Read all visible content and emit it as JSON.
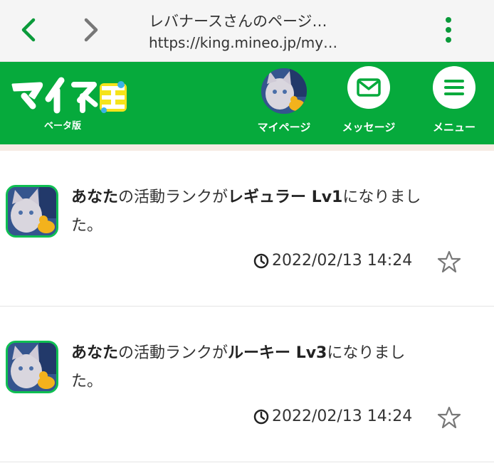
{
  "browser": {
    "page_title": "レバナースさんのページ…",
    "url": "https://king.mineo.jp/my…"
  },
  "header": {
    "logo_text": "マイネ王",
    "logo_sub": "ベータ版",
    "buttons": [
      {
        "label": "マイページ"
      },
      {
        "label": "メッセージ"
      },
      {
        "label": "メニュー"
      }
    ]
  },
  "feed": {
    "items": [
      {
        "subject": "あなた",
        "middle": "の活動ランクが",
        "rank": "レギュラー Lv1",
        "line1_tail": "になりまし",
        "line2": "た。",
        "timestamp": "2022/02/13 14:24"
      },
      {
        "subject": "あなた",
        "middle": "の活動ランクが",
        "rank": "ルーキー Lv3",
        "line1_tail": "になりまし",
        "line2": "た。",
        "timestamp": "2022/02/13 14:24"
      }
    ]
  },
  "colors": {
    "brand_green": "#06aa3c",
    "avatar_border": "#0fbf52",
    "accent_yellow": "#f5e31a"
  }
}
